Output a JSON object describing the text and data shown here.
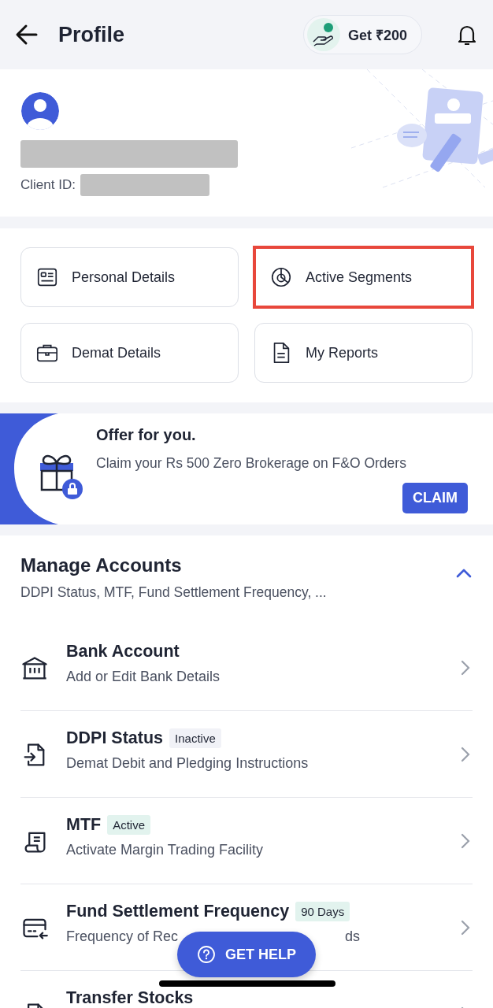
{
  "header": {
    "title": "Profile",
    "referral": "Get ₹200"
  },
  "profile": {
    "client_id_label": "Client ID:"
  },
  "tiles": [
    {
      "label": "Personal Details",
      "highlighted": false
    },
    {
      "label": "Active Segments",
      "highlighted": true
    },
    {
      "label": "Demat Details",
      "highlighted": false
    },
    {
      "label": "My Reports",
      "highlighted": false
    }
  ],
  "offer": {
    "title": "Offer for you.",
    "text": "Claim your Rs 500 Zero Brokerage on F&O Orders",
    "button": "CLAIM"
  },
  "manage": {
    "title": "Manage Accounts",
    "summary": "DDPI Status, MTF, Fund Settlement Frequency, ...",
    "expanded": true,
    "rows": [
      {
        "title": "Bank Account",
        "subtitle": "Add or Edit Bank Details"
      },
      {
        "title": "DDPI Status",
        "badge": {
          "text": "Inactive",
          "kind": "neutral"
        },
        "subtitle": "Demat Debit and Pledging Instructions"
      },
      {
        "title": "MTF",
        "badge": {
          "text": "Active",
          "kind": "success"
        },
        "subtitle": "Activate Margin Trading Facility"
      },
      {
        "title": "Fund Settlement Frequency",
        "badge": {
          "text": "90 Days",
          "kind": "success"
        },
        "subtitle_parts": [
          "Frequency of Rec",
          "ds"
        ]
      },
      {
        "title": "Transfer Stocks"
      }
    ]
  },
  "help_button": "GET HELP"
}
